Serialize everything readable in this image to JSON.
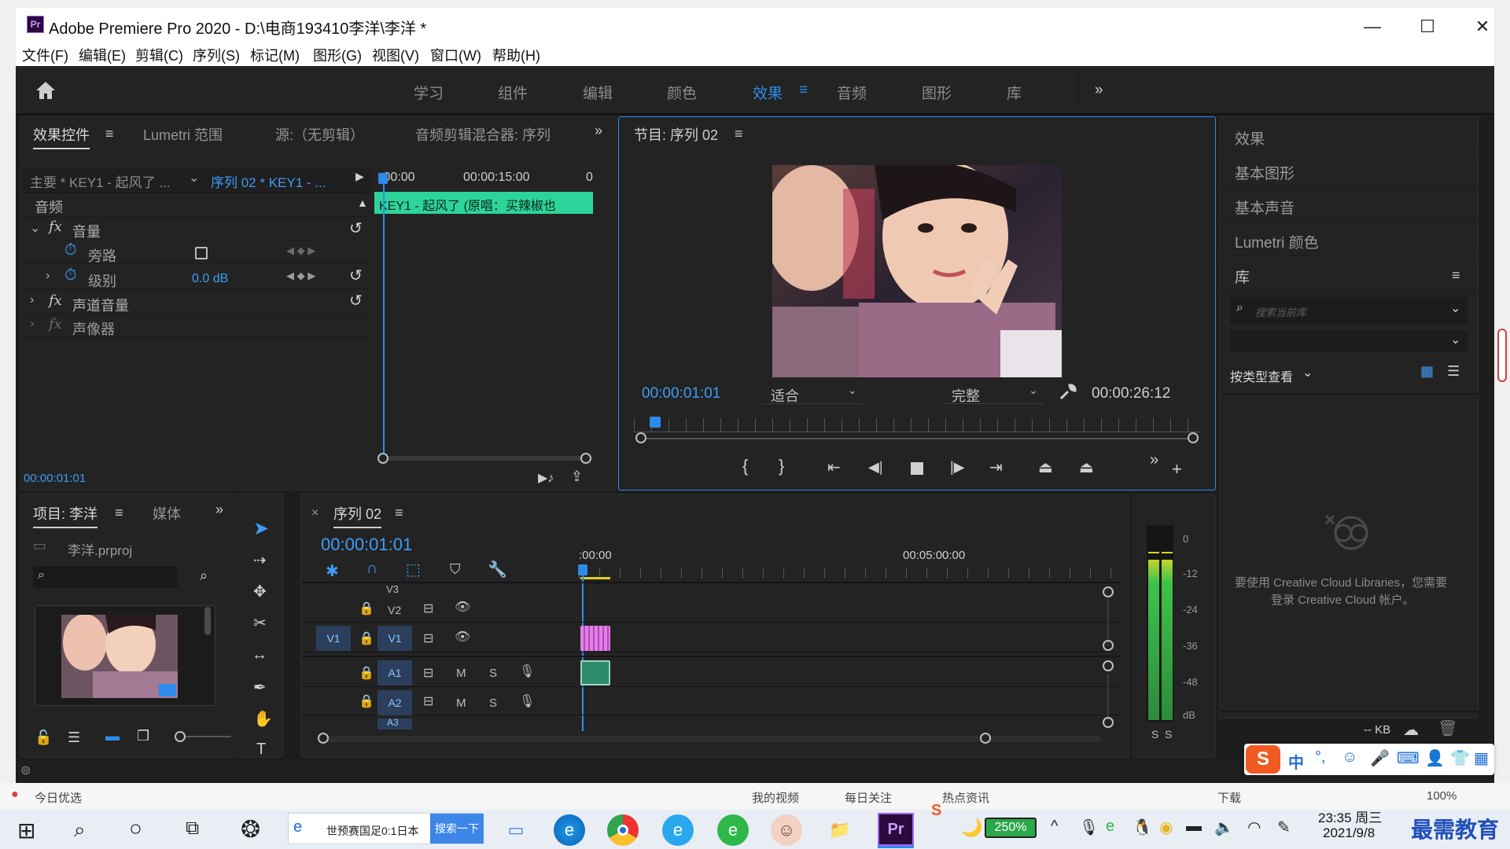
{
  "window": {
    "app_badge": "Pr",
    "title": "Adobe Premiere Pro 2020 - D:\\电商193410李洋\\李洋 *",
    "minimize_glyph": "—",
    "maximize_glyph": "☐",
    "close_glyph": "✕"
  },
  "menu": [
    "文件(F)",
    "编辑(E)",
    "剪辑(C)",
    "序列(S)",
    "标记(M)",
    "图形(G)",
    "视图(V)",
    "窗口(W)",
    "帮助(H)"
  ],
  "workspaces": {
    "items": [
      "学习",
      "组件",
      "编辑",
      "颜色",
      "效果",
      "音频",
      "图形",
      "库"
    ],
    "active": "效果",
    "overflow_glyph": "»"
  },
  "effect_controls": {
    "tabs": [
      "效果控件",
      "Lumetri 范围",
      "源:（无剪辑）",
      "音频剪辑混合器: 序列"
    ],
    "master_label": "主要 * KEY1 - 起风了 ...",
    "sequence_label": "序列 02 * KEY1 - ...",
    "ruler": [
      ":00:00",
      "00:00:15:00",
      "0"
    ],
    "clip_name": "KEY1 - 起风了 (原唱：买辣椒也",
    "section_audio": "音频",
    "fx_volume": "音量",
    "bypass": "旁路",
    "level": "级别",
    "level_value": "0.0 dB",
    "fx_channel": "声道音量",
    "fx_panner": "声像器",
    "timecode": "00:00:01:01"
  },
  "program_monitor": {
    "title": "节目: 序列 02",
    "timecode": "00:00:01:01",
    "fit_select": "适合",
    "quality_select": "完整",
    "duration": "00:00:26:12"
  },
  "right_panel": {
    "items": [
      "效果",
      "基本图形",
      "基本声音",
      "Lumetri 颜色"
    ],
    "library_title": "库",
    "search_placeholder": "搜索当前库",
    "view_by_type": "按类型查看",
    "cc_message_line1": "要使用 Creative Cloud Libraries，您需要",
    "cc_message_line2": "登录 Creative Cloud 帐户。",
    "storage": "-- KB"
  },
  "project": {
    "tabs": [
      "项目: 李洋",
      "媒体"
    ],
    "file": "李洋.prproj"
  },
  "timeline": {
    "sequence_tab": "序列 02",
    "timecode": "00:00:01:01",
    "ruler": [
      ":00:00",
      "00:05:00:00"
    ],
    "video_tracks": [
      "V3",
      "V2",
      "V1"
    ],
    "audio_tracks": [
      "A1",
      "A2",
      "A3"
    ],
    "source_patch": "V1",
    "mute": "M",
    "solo": "S"
  },
  "audio_meter": {
    "scale": [
      "0",
      "-12",
      "-24",
      "-36",
      "-48",
      "dB"
    ],
    "solo_buttons": [
      "S",
      "S"
    ]
  },
  "status_strip": {
    "items": [
      "今日优选",
      "我的视频",
      "每日关注",
      "热点资讯",
      "下载",
      "100%"
    ]
  },
  "taskbar": {
    "search_text": "世预赛国足0:1日本",
    "search_button": "搜索一下",
    "battery": "250%",
    "time": "23:35 周三",
    "date": "2021/9/8",
    "ime_label": "中",
    "watermark": "最需教育"
  },
  "colors": {
    "accent": "#2d8ceb",
    "clip_green": "#2dd49a",
    "clip_pink": "#e57fe6",
    "panel_bg": "#232323"
  },
  "icons": [
    "home-icon",
    "wrench-icon",
    "play-icon",
    "step-back-icon",
    "step-forward-icon",
    "stop-icon",
    "mic-icon",
    "eye-icon",
    "lock-icon",
    "trash-icon",
    "cloud-icon"
  ]
}
